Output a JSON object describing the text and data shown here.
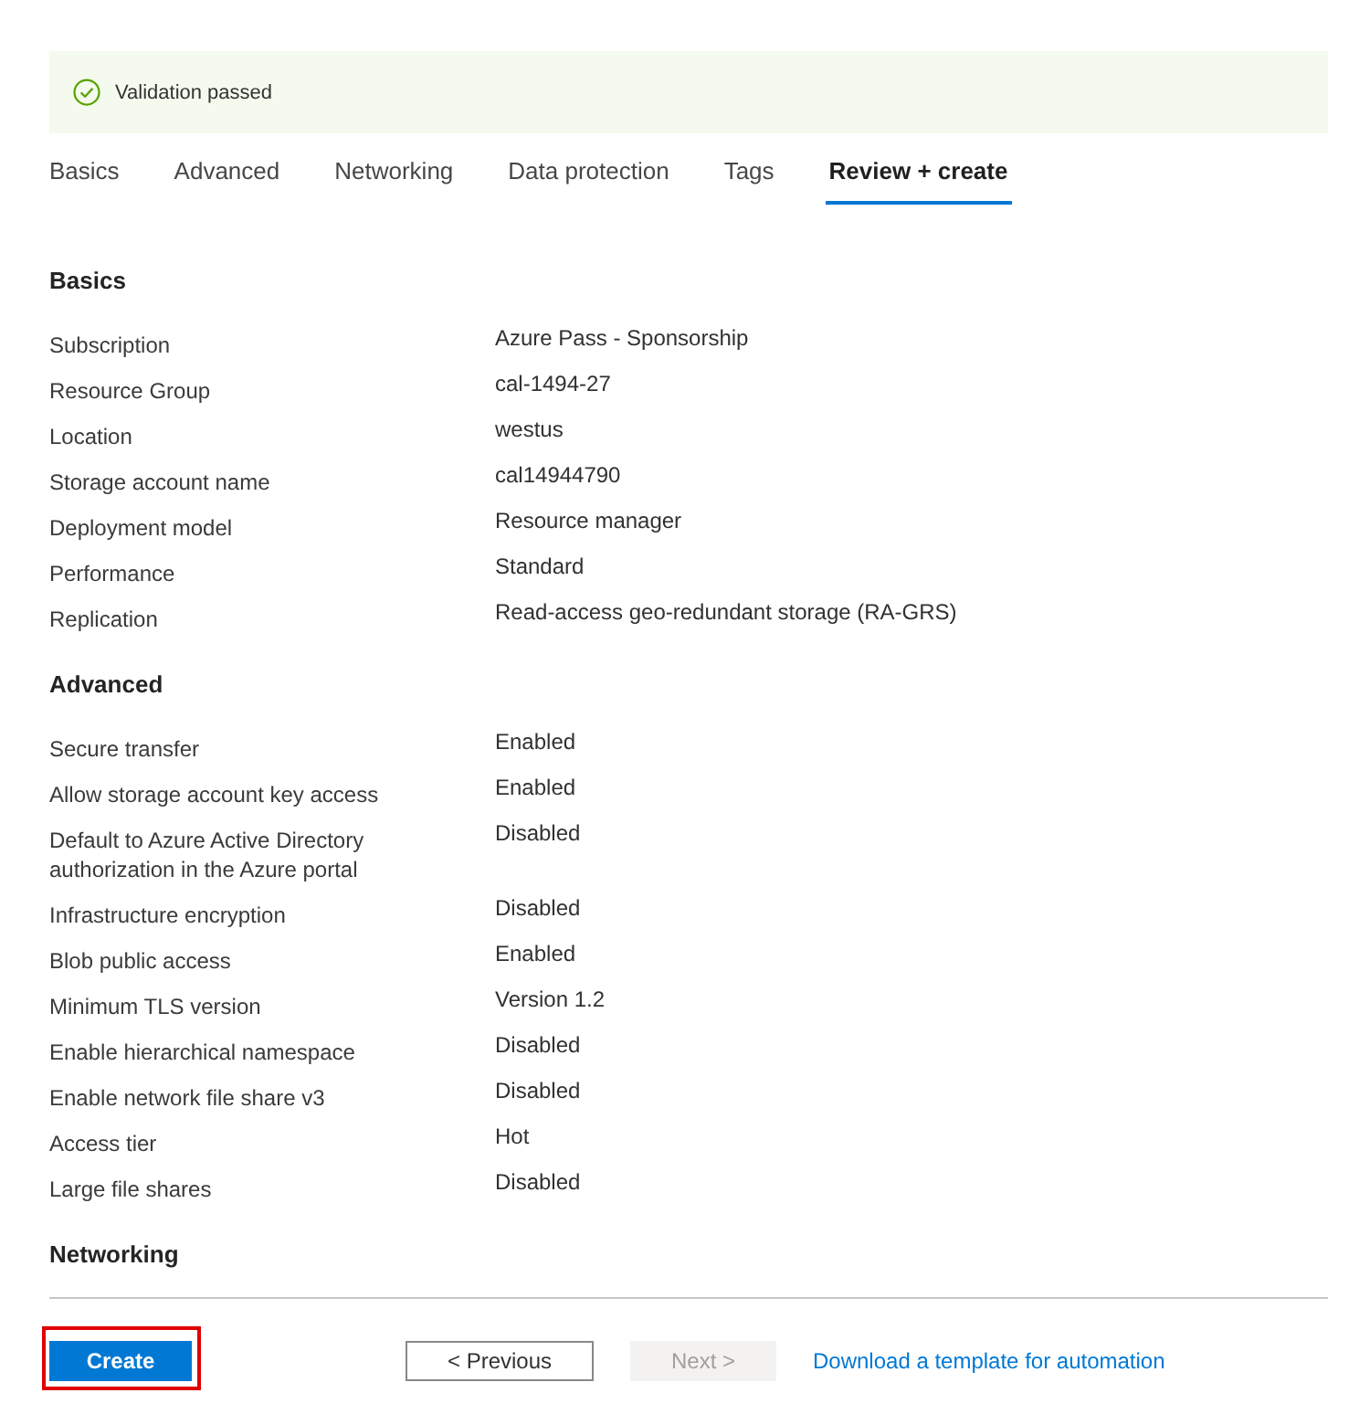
{
  "banner": {
    "kind": "success",
    "message": "Validation passed"
  },
  "tabs": [
    {
      "label": "Basics",
      "selected": false
    },
    {
      "label": "Advanced",
      "selected": false
    },
    {
      "label": "Networking",
      "selected": false
    },
    {
      "label": "Data protection",
      "selected": false
    },
    {
      "label": "Tags",
      "selected": false
    },
    {
      "label": "Review + create",
      "selected": true
    }
  ],
  "sections": [
    {
      "title": "Basics",
      "rows": [
        {
          "label": "Subscription",
          "value": "Azure Pass - Sponsorship"
        },
        {
          "label": "Resource Group",
          "value": "cal-1494-27"
        },
        {
          "label": "Location",
          "value": "westus"
        },
        {
          "label": "Storage account name",
          "value": "cal14944790"
        },
        {
          "label": "Deployment model",
          "value": "Resource manager"
        },
        {
          "label": "Performance",
          "value": "Standard"
        },
        {
          "label": "Replication",
          "value": "Read-access geo-redundant storage (RA-GRS)"
        }
      ]
    },
    {
      "title": "Advanced",
      "rows": [
        {
          "label": "Secure transfer",
          "value": "Enabled"
        },
        {
          "label": "Allow storage account key access",
          "value": "Enabled"
        },
        {
          "label": "Default to Azure Active Directory authorization in the Azure portal",
          "value": "Disabled"
        },
        {
          "label": "Infrastructure encryption",
          "value": "Disabled"
        },
        {
          "label": "Blob public access",
          "value": "Enabled"
        },
        {
          "label": "Minimum TLS version",
          "value": "Version 1.2"
        },
        {
          "label": "Enable hierarchical namespace",
          "value": "Disabled"
        },
        {
          "label": "Enable network file share v3",
          "value": "Disabled"
        },
        {
          "label": "Access tier",
          "value": "Hot"
        },
        {
          "label": "Large file shares",
          "value": "Disabled"
        }
      ]
    },
    {
      "title": "Networking"
    }
  ],
  "footer": {
    "buttons": [
      {
        "kind": "primary",
        "label": "Create",
        "disabled": false,
        "highlighted": true
      },
      {
        "kind": "secondary",
        "label": "< Previous",
        "disabled": false,
        "highlighted": false
      },
      {
        "kind": "secondary",
        "label": "Next >",
        "disabled": true,
        "highlighted": false
      }
    ],
    "link": "Download a template for automation"
  }
}
